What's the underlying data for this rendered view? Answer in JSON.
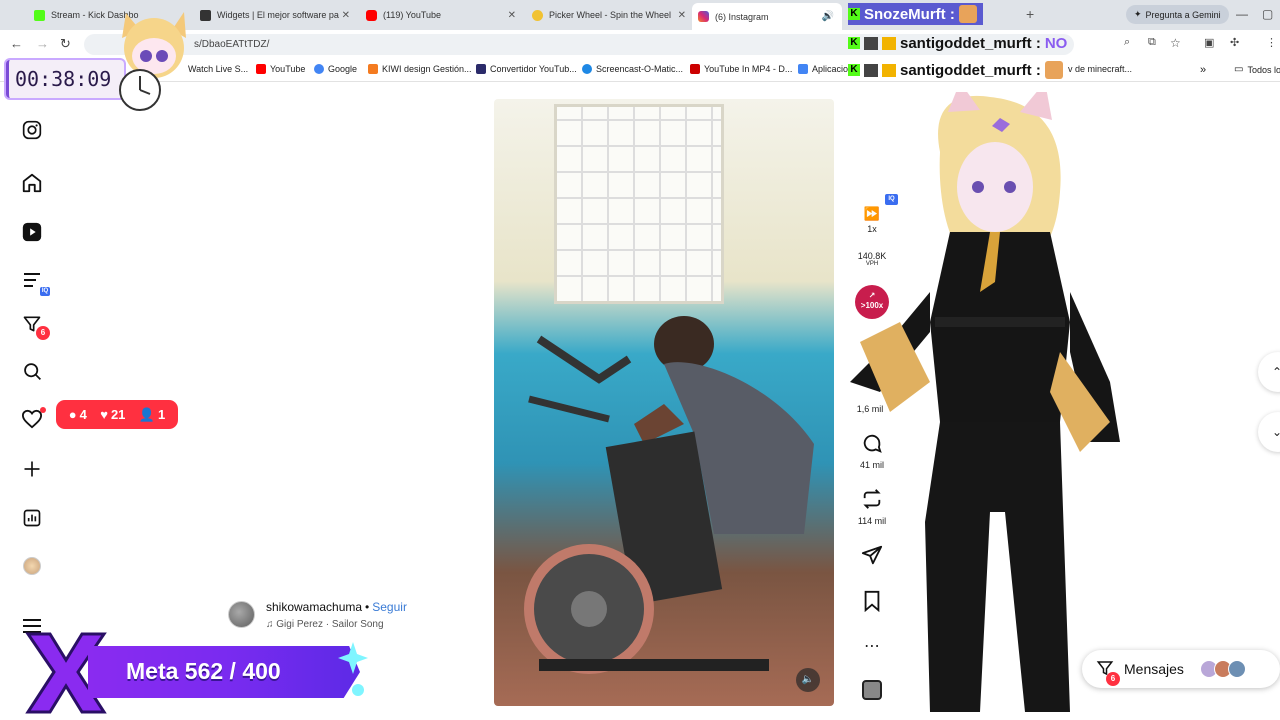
{
  "browser": {
    "tabs": [
      {
        "title": "Stream - Kick Dashbo",
        "favicon_color": "#53fc18"
      },
      {
        "title": "Widgets | El mejor software pa",
        "favicon_color": "#333333"
      },
      {
        "title": "(119) YouTube",
        "favicon_color": "#ff0000"
      },
      {
        "title": "Picker Wheel - Spin the Wheel",
        "favicon_color": "#f1c232"
      },
      {
        "title": "(6) Instagram",
        "favicon_color": "#d62976"
      }
    ],
    "gemini_label": "Pregunta a Gemini",
    "url_path": "s/DbaoEATtTDZ/",
    "bookmarks": [
      {
        "label": "Watch Live S...",
        "color": "#ffffff"
      },
      {
        "label": "YouTube",
        "color": "#ff0000"
      },
      {
        "label": "Google",
        "color": "#4285f4"
      },
      {
        "label": "KIWI design Gestión...",
        "color": "#f47b20"
      },
      {
        "label": "Convertidor YouTub...",
        "color": "#2b2b6a"
      },
      {
        "label": "Screencast-O-Matic...",
        "color": "#1e88e5"
      },
      {
        "label": "YouTube In MP4 - D...",
        "color": "#cc0000"
      },
      {
        "label": "Aplicacio",
        "color": "#4285f4"
      },
      {
        "label": "v de minecraft...",
        "color": "#7a7a7a"
      }
    ],
    "all_bookmarks_label": "Todos los"
  },
  "sidebar": {
    "filter_badge": "6",
    "notifications": {
      "comments": "4",
      "likes": "21",
      "follows": "1"
    }
  },
  "reel": {
    "speed": "1x",
    "vph": "140.8K",
    "vph_label": "VPH",
    "iq_badge": "IQ",
    "boost_label": ">100x",
    "likes": "1,6 mil",
    "comments": "41 mil",
    "reposts": "114 mil",
    "author": "shikowamachuma",
    "separator": "•",
    "follow_label": "Seguir",
    "song": "Gigi Perez · Sailor Song"
  },
  "messages": {
    "label": "Mensajes",
    "badge": "6"
  },
  "stream": {
    "timer": "00:38:09",
    "chat": [
      {
        "user": "SnozeMurft :"
      },
      {
        "user": "santigoddet_murft :",
        "message": "NO"
      },
      {
        "user": "santigoddet_murft :"
      }
    ],
    "goal": "Meta 562 / 400"
  },
  "colors": {
    "instagram_red": "#ff3040",
    "kick_green": "#53fc18",
    "goal_purple": "#8a2bf0"
  }
}
